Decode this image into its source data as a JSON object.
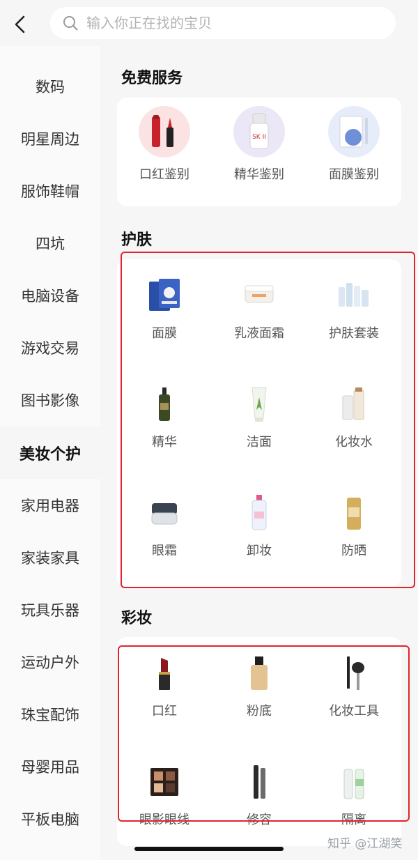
{
  "header": {
    "search_placeholder": "输入你正在找的宝贝"
  },
  "sidebar": {
    "items": [
      {
        "label": "数码"
      },
      {
        "label": "明星周边"
      },
      {
        "label": "服饰鞋帽"
      },
      {
        "label": "四坑"
      },
      {
        "label": "电脑设备"
      },
      {
        "label": "游戏交易"
      },
      {
        "label": "图书影像"
      },
      {
        "label": "美妆个护"
      },
      {
        "label": "家用电器"
      },
      {
        "label": "家装家具"
      },
      {
        "label": "玩具乐器"
      },
      {
        "label": "运动户外"
      },
      {
        "label": "珠宝配饰"
      },
      {
        "label": "母婴用品"
      },
      {
        "label": "平板电脑"
      }
    ],
    "active": "美妆个护"
  },
  "sections": {
    "free": {
      "title": "免费服务",
      "items": [
        {
          "label": "口红鉴别"
        },
        {
          "label": "精华鉴别"
        },
        {
          "label": "面膜鉴别"
        }
      ]
    },
    "skincare": {
      "title": "护肤",
      "items": [
        {
          "label": "面膜"
        },
        {
          "label": "乳液面霜"
        },
        {
          "label": "护肤套装"
        },
        {
          "label": "精华"
        },
        {
          "label": "洁面"
        },
        {
          "label": "化妆水"
        },
        {
          "label": "眼霜"
        },
        {
          "label": "卸妆"
        },
        {
          "label": "防晒"
        }
      ]
    },
    "makeup": {
      "title": "彩妆",
      "items": [
        {
          "label": "口红"
        },
        {
          "label": "粉底"
        },
        {
          "label": "化妆工具"
        },
        {
          "label": "眼影眼线"
        },
        {
          "label": "修容"
        },
        {
          "label": "隔离"
        }
      ]
    }
  },
  "watermark": "知乎 @江湖笑",
  "colors": {
    "highlight_border": "#e0242f",
    "background": "#f6f6f6"
  }
}
